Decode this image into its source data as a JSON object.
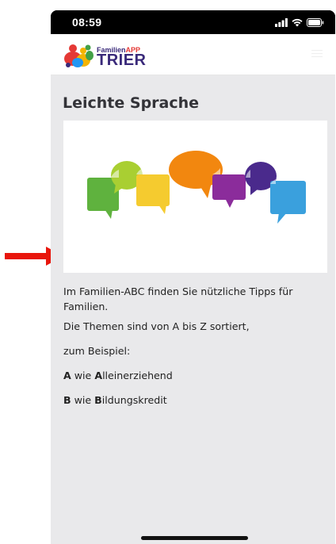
{
  "status_bar": {
    "time": "08:59",
    "icons": [
      "signal-icon",
      "wifi-icon",
      "battery-icon"
    ]
  },
  "header": {
    "logo": {
      "line1_part1": "Familien",
      "line1_part2": "APP",
      "line2": "TRIER"
    },
    "menu_icon": "hamburger-menu-icon"
  },
  "page": {
    "title": "Leichte Sprache",
    "image_description_icons": "speech-bubbles-illustration",
    "paragraph1": "Im Familien-ABC finden Sie nützliche Tipps für Familien.",
    "paragraph2": "Die Themen sind von A bis Z sortiert,",
    "paragraph3": "zum Beispiel:",
    "example_a": {
      "letter": "A",
      "middle": " wie ",
      "bold_letter": "A",
      "rest": "lleinerziehend"
    },
    "example_b": {
      "letter": "B",
      "middle": " wie ",
      "bold_letter": "B",
      "rest": "ildungskredit"
    }
  },
  "colors": {
    "accent_red": "#e8160c",
    "background": "#e9e9eb",
    "logo_purple": "#3a2a7a"
  }
}
